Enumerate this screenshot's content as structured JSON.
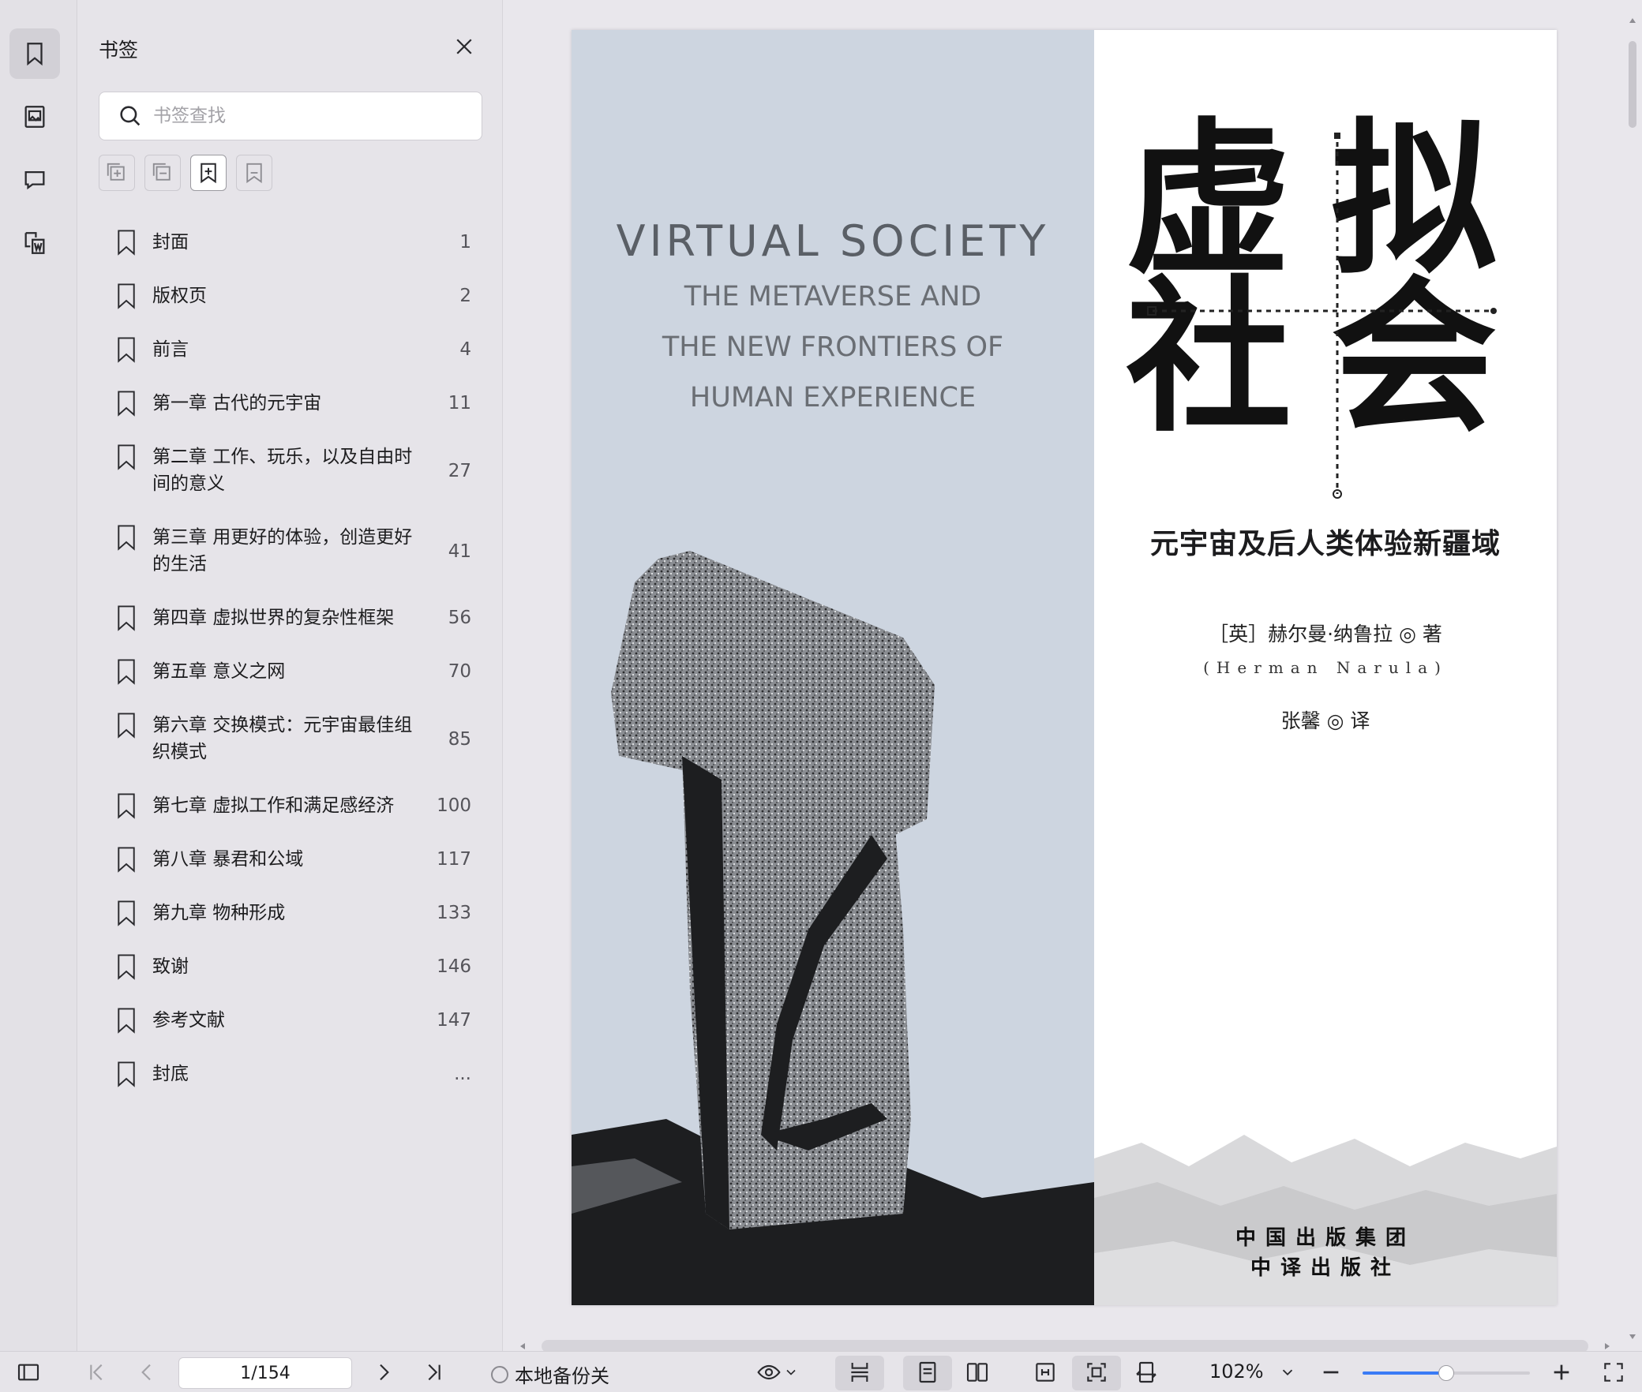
{
  "panel": {
    "title": "书签",
    "search_placeholder": "书签查找"
  },
  "bookmarks": [
    {
      "label": "封面",
      "page": "1"
    },
    {
      "label": "版权页",
      "page": "2"
    },
    {
      "label": "前言",
      "page": "4"
    },
    {
      "label": "第一章 古代的元宇宙",
      "page": "11"
    },
    {
      "label": "第二章 工作、玩乐，以及自由时间的意义",
      "page": "27"
    },
    {
      "label": "第三章 用更好的体验，创造更好的生活",
      "page": "41"
    },
    {
      "label": "第四章 虚拟世界的复杂性框架",
      "page": "56"
    },
    {
      "label": "第五章 意义之网",
      "page": "70"
    },
    {
      "label": "第六章 交换模式：元宇宙最佳组织模式",
      "page": "85"
    },
    {
      "label": "第七章 虚拟工作和满足感经济",
      "page": "100"
    },
    {
      "label": "第八章 暴君和公域",
      "page": "117"
    },
    {
      "label": "第九章 物种形成",
      "page": "133"
    },
    {
      "label": "致谢",
      "page": "146"
    },
    {
      "label": "参考文献",
      "page": "147"
    },
    {
      "label": "封底",
      "page": "..."
    }
  ],
  "cover": {
    "en_title": "VIRTUAL SOCIETY",
    "en_sub_1": "THE METAVERSE AND",
    "en_sub_2": "THE NEW FRONTIERS OF",
    "en_sub_3": "HUMAN EXPERIENCE",
    "cn_char_1": "虚",
    "cn_char_2": "拟",
    "cn_char_3": "社",
    "cn_char_4": "会",
    "cn_subtitle": "元宇宙及后人类体验新疆域",
    "author": "［英］赫尔曼·纳鲁拉 ◎ 著",
    "author_en": "(Herman Narula)",
    "translator": "张馨 ◎ 译",
    "publisher_1": "中国出版集团",
    "publisher_2": "中译出版社"
  },
  "statusbar": {
    "page_value": "1/154",
    "backup_label": "本地备份关",
    "zoom_label": "102%",
    "zoom_level_fraction": 0.5
  },
  "colors": {
    "accent": "#3a7bf5",
    "cover_blue": "#cdd5e0"
  }
}
